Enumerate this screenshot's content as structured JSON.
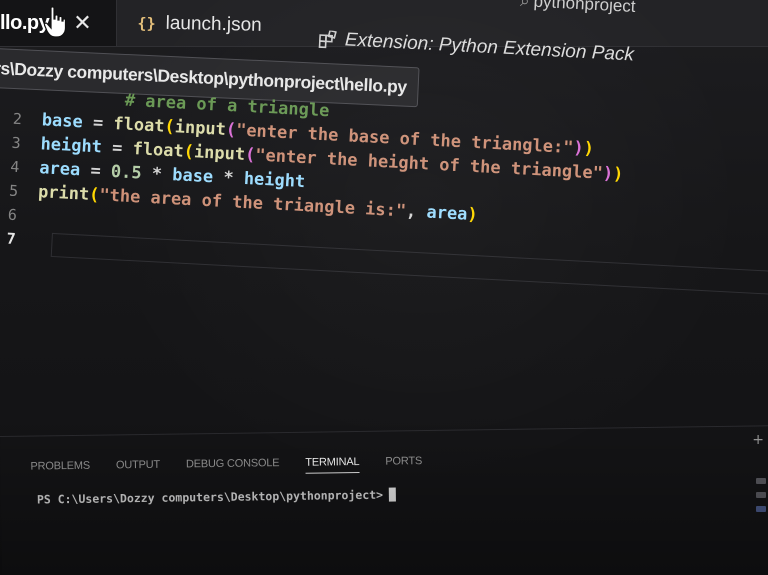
{
  "window": {
    "title": "pythonproject"
  },
  "tabs": [
    {
      "label": "llo.py",
      "active": true,
      "icon": "close-icon"
    },
    {
      "label": "launch.json",
      "active": false,
      "icon": "json-braces-icon"
    },
    {
      "label": "Extension: Python Extension Pack",
      "active": false,
      "icon": "extension-icon"
    }
  ],
  "breadcrumb": {
    "path": "rs\\Dozzy computers\\Desktop\\pythonproject\\hello.py"
  },
  "editor": {
    "lines": [
      {
        "number": "",
        "comment": "# area of a triangle"
      },
      {
        "number": "2",
        "var": "base",
        "op": " = ",
        "fn1": "float",
        "p1": "(",
        "fn2": "input",
        "p2": "(",
        "str": "\"enter the base of the triangle:\"",
        "c2": ")",
        "c1": ")"
      },
      {
        "number": "3",
        "var": "height",
        "op": " = ",
        "fn1": "float",
        "p1": "(",
        "fn2": "input",
        "p2": "(",
        "str": "\"enter the height of the triangle\"",
        "c2": ")",
        "c1": ")"
      },
      {
        "number": "4",
        "var": "area",
        "op": " = ",
        "num": "0.5",
        "op2": " * ",
        "var2": "base",
        "op3": " * ",
        "var3": "height"
      },
      {
        "number": "5",
        "fn1": "print",
        "p1": "(",
        "str": "\"the area of the triangle is:\"",
        "op": ", ",
        "var": "area",
        "c1": ")"
      },
      {
        "number": "6"
      },
      {
        "number": "7"
      }
    ],
    "active_line": "7"
  },
  "panel": {
    "tabs": [
      "PROBLEMS",
      "OUTPUT",
      "DEBUG CONSOLE",
      "TERMINAL",
      "PORTS"
    ],
    "active_tab": "TERMINAL",
    "terminal_prompt": "PS C:\\Users\\Dozzy computers\\Desktop\\pythonproject>"
  },
  "colors": {
    "comment": "#6a9955",
    "variable": "#9cdcfe",
    "function": "#dcdcaa",
    "string": "#ce9178",
    "number": "#b5cea8",
    "bracket_outer": "#ffd700",
    "bracket_inner": "#da70d6"
  }
}
